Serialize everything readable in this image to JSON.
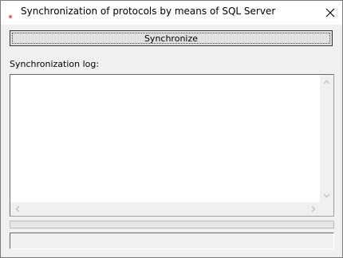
{
  "window": {
    "title": "Synchronization of protocols by means of SQL Server",
    "app_icon": "app-icon",
    "close_icon": "close-icon"
  },
  "toolbar": {
    "synchronize_label": "Synchronize"
  },
  "log": {
    "label": "Synchronization log:",
    "content": ""
  },
  "progress": {
    "value": 0
  },
  "status": {
    "text": ""
  },
  "colors": {
    "window_bg": "#f0f0f0",
    "titlebar_bg": "#ffffff",
    "progress_fill": "#06b025"
  }
}
